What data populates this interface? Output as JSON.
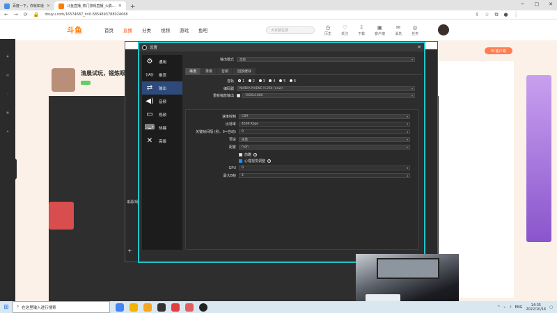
{
  "browser": {
    "tabs": [
      {
        "title": "百度一下，你就知道",
        "active": false
      },
      {
        "title": "斗鱼直播_热门游戏直播_火影...",
        "active": true
      }
    ],
    "url": "douyu.com/16574687_t=0.6854893788024068",
    "window_controls": [
      "−",
      "□",
      "✕"
    ]
  },
  "site": {
    "logo": "斗鱼",
    "nav": [
      "首页",
      "直播",
      "分类",
      "视频",
      "游戏",
      "鱼吧"
    ],
    "active_nav": "直播",
    "search_placeholder": "大家都在搜",
    "header_icons": [
      "历史",
      "关注",
      "下载",
      "客户端",
      "消息",
      "任务"
    ],
    "room_title": "清晨试玩，锻炼眼睛",
    "pc_button": "PC客户端",
    "theme_color": "#ff7a00"
  },
  "obs_main": {
    "scenes_label": "来源/场景",
    "add_label": "+"
  },
  "settings": {
    "title": "设置",
    "accent": "#22c5cc",
    "sidebar": [
      {
        "label": "通用",
        "icon": "gear-icon",
        "glyph": "⚙"
      },
      {
        "label": "推流",
        "icon": "stream-icon",
        "glyph": "((A))"
      },
      {
        "label": "输出",
        "icon": "output-icon",
        "glyph": "⇄"
      },
      {
        "label": "音频",
        "icon": "speaker-icon",
        "glyph": "🔊"
      },
      {
        "label": "视频",
        "icon": "monitor-icon",
        "glyph": "▭"
      },
      {
        "label": "热键",
        "icon": "keyboard-icon",
        "glyph": "⌨"
      },
      {
        "label": "高级",
        "icon": "tools-icon",
        "glyph": "✕"
      }
    ],
    "active_sidebar": "输出",
    "output_mode_label": "输出模式",
    "output_mode_value": "高级",
    "subtabs": [
      "串流",
      "录像",
      "音频",
      "回放缓存"
    ],
    "active_subtab": "串流",
    "audio_track_label": "音轨",
    "audio_tracks": [
      "1",
      "2",
      "3",
      "4",
      "5",
      "6"
    ],
    "encoder_label": "编码器",
    "encoder_value": "NVIDIA NVENC H.264 (new)",
    "rescale_label": "重新缩放输出",
    "rescale_value": "1920x1080",
    "rate_control_label": "速率控制",
    "rate_control_value": "CBR",
    "bitrate_label": "比特率",
    "bitrate_value": "4500 Kbps",
    "keyframe_label": "关键帧间隔 (秒，0=自动)",
    "keyframe_value": "0",
    "preset_label": "预设",
    "preset_value": "质量",
    "profile_label": "配置",
    "profile_value": "high",
    "lookahead_label": "前瞻",
    "psycho_label": "心理视觉调整",
    "gpu_label": "GPU",
    "gpu_value": "0",
    "bframes_label": "最大B帧",
    "bframes_value": "2"
  },
  "taskbar": {
    "search_placeholder": "在这里输入进行搜索",
    "language": "ENG",
    "time": "14:35",
    "date": "2022/10/16"
  }
}
